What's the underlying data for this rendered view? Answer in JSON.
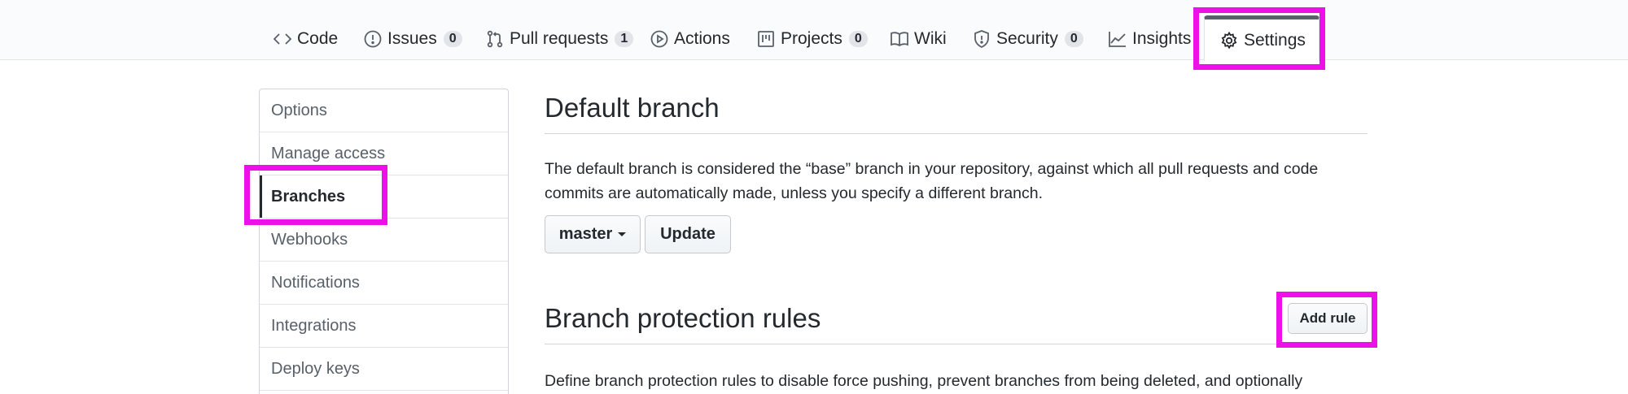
{
  "tabs": [
    {
      "label": "Code",
      "icon": "code-icon"
    },
    {
      "label": "Issues",
      "icon": "issue-opened-icon",
      "count": "0"
    },
    {
      "label": "Pull requests",
      "icon": "git-pull-request-icon",
      "count": "1"
    },
    {
      "label": "Actions",
      "icon": "play-icon"
    },
    {
      "label": "Projects",
      "icon": "project-icon",
      "count": "0"
    },
    {
      "label": "Wiki",
      "icon": "book-icon"
    },
    {
      "label": "Security",
      "icon": "shield-icon",
      "count": "0"
    },
    {
      "label": "Insights",
      "icon": "graph-icon"
    },
    {
      "label": "Settings",
      "icon": "gear-icon",
      "selected": true
    }
  ],
  "sidebar": {
    "items": [
      {
        "label": "Options"
      },
      {
        "label": "Manage access"
      },
      {
        "label": "Branches",
        "active": true
      },
      {
        "label": "Webhooks"
      },
      {
        "label": "Notifications"
      },
      {
        "label": "Integrations"
      },
      {
        "label": "Deploy keys"
      }
    ]
  },
  "default_branch": {
    "title": "Default branch",
    "description": "The default branch is considered the “base” branch in your repository, against which all pull requests and code commits are automatically made, unless you specify a different branch.",
    "branch_select": "master",
    "update_label": "Update"
  },
  "protection": {
    "title": "Branch protection rules",
    "add_rule_label": "Add rule",
    "description": "Define branch protection rules to disable force pushing, prevent branches from being deleted, and optionally"
  },
  "colors": {
    "highlight": "#ee10e8",
    "text": "#24292e",
    "muted": "#586069",
    "border": "#d1d5da"
  }
}
